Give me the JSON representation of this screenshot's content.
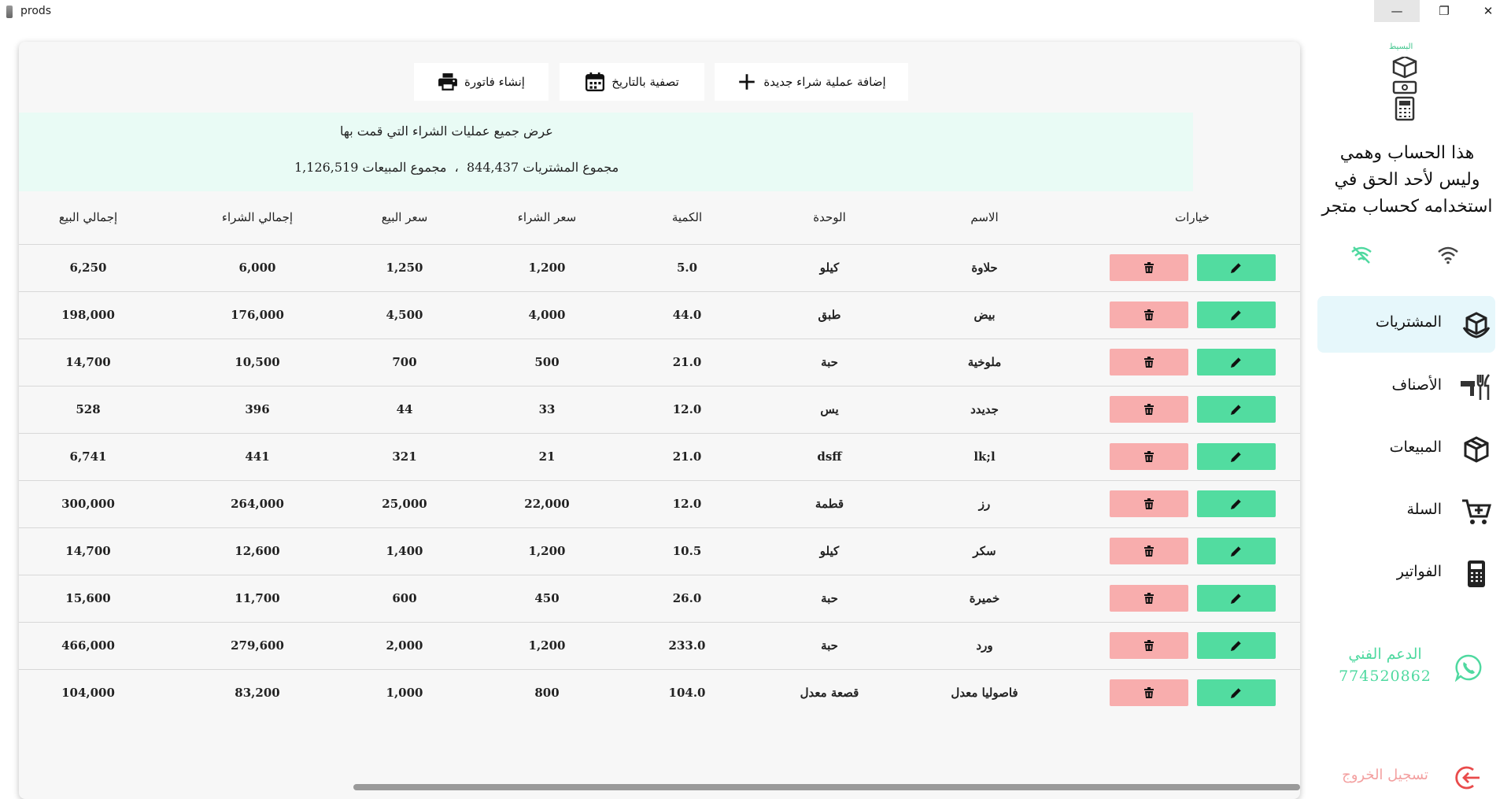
{
  "window": {
    "title": "prods",
    "min": "—",
    "max": "❐",
    "close": "✕"
  },
  "toolbar": {
    "invoice_label": "إنشاء فاتورة",
    "filter_label": "تصفية بالتاريخ",
    "add_label": "إضافة عملية شراء جديدة"
  },
  "info": {
    "heading": "عرض جميع عمليات الشراء التي قمت بها",
    "purchases_label": "مجموع المشتريات",
    "purchases_total": "844,437",
    "separator": "،",
    "sales_label": "مجموع المبيعات",
    "sales_total": "1,126,519"
  },
  "table": {
    "headers": {
      "options": "خيارات",
      "name": "الاسم",
      "unit": "الوحدة",
      "qty": "الكمية",
      "buy_price": "سعر الشراء",
      "sell_price": "سعر البيع",
      "buy_total": "إجمالي الشراء",
      "sell_total": "إجمالي البيع"
    },
    "rows": [
      {
        "name": "حلاوة",
        "unit": "كيلو",
        "qty": "5.0",
        "buy_price": "1,200",
        "sell_price": "1,250",
        "buy_total": "6,000",
        "sell_total": "6,250"
      },
      {
        "name": "بيض",
        "unit": "طبق",
        "qty": "44.0",
        "buy_price": "4,000",
        "sell_price": "4,500",
        "buy_total": "176,000",
        "sell_total": "198,000"
      },
      {
        "name": "ملوخية",
        "unit": "حبة",
        "qty": "21.0",
        "buy_price": "500",
        "sell_price": "700",
        "buy_total": "10,500",
        "sell_total": "14,700"
      },
      {
        "name": "جديدد",
        "unit": "يس",
        "qty": "12.0",
        "buy_price": "33",
        "sell_price": "44",
        "buy_total": "396",
        "sell_total": "528"
      },
      {
        "name": "lk;l",
        "unit": "dsff",
        "qty": "21.0",
        "buy_price": "21",
        "sell_price": "321",
        "buy_total": "441",
        "sell_total": "6,741"
      },
      {
        "name": "رز",
        "unit": "قطمة",
        "qty": "12.0",
        "buy_price": "22,000",
        "sell_price": "25,000",
        "buy_total": "264,000",
        "sell_total": "300,000"
      },
      {
        "name": "سكر",
        "unit": "كيلو",
        "qty": "10.5",
        "buy_price": "1,200",
        "sell_price": "1,400",
        "buy_total": "12,600",
        "sell_total": "14,700"
      },
      {
        "name": "خميرة",
        "unit": "حبة",
        "qty": "26.0",
        "buy_price": "450",
        "sell_price": "600",
        "buy_total": "11,700",
        "sell_total": "15,600"
      },
      {
        "name": "ورد",
        "unit": "حبة",
        "qty": "233.0",
        "buy_price": "1,200",
        "sell_price": "2,000",
        "buy_total": "279,600",
        "sell_total": "466,000"
      },
      {
        "name": "فاصوليا معدل",
        "unit": "قصعة معدل",
        "qty": "104.0",
        "buy_price": "800",
        "sell_price": "1,000",
        "buy_total": "83,200",
        "sell_total": "104,000"
      }
    ]
  },
  "sidebar": {
    "logo_text": "البسيط",
    "notice": "هذا الحساب وهمي وليس لأحد الحق في استخدامه كحساب متجر",
    "nav": [
      {
        "label": "المشتريات",
        "icon": "purchases-box-icon",
        "active": true
      },
      {
        "label": "الأصناف",
        "icon": "categories-utensils-icon",
        "active": false
      },
      {
        "label": "المبيعات",
        "icon": "sales-box-icon",
        "active": false
      },
      {
        "label": "السلة",
        "icon": "cart-plus-icon",
        "active": false
      },
      {
        "label": "الفواتير",
        "icon": "calculator-icon",
        "active": false
      }
    ],
    "support_label": "الدعم الفني",
    "support_phone": "774520862",
    "logout_label": "تسجيل الخروج"
  },
  "colors": {
    "edit": "#52dca0",
    "delete": "#f8adad",
    "info_bg": "#e9fbf5",
    "active_nav": "#e6f7fb",
    "support": "#4fd9a0",
    "logout": "#f3a0a0"
  }
}
